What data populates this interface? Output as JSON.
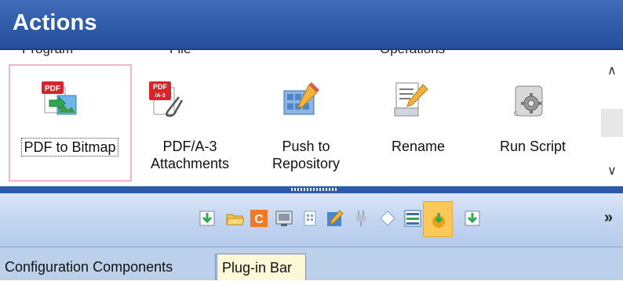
{
  "header": {
    "title": "Actions"
  },
  "categories": [
    {
      "id": "program",
      "label": "Program"
    },
    {
      "id": "file",
      "label": "File"
    },
    {
      "id": "operations",
      "label": "Operations"
    }
  ],
  "actions": [
    {
      "id": "pdf-to-bitmap",
      "label_lines": [
        "PDF to Bitmap",
        ""
      ],
      "icon": "pdf-to-bitmap-icon",
      "selected": true
    },
    {
      "id": "pdfa3-attachments",
      "label_lines": [
        "PDF/A-3",
        "Attachments"
      ],
      "icon": "pdfa3-attachment-icon",
      "selected": false
    },
    {
      "id": "push-to-repository",
      "label_lines": [
        "Push to",
        "Repository"
      ],
      "icon": "repository-icon",
      "selected": false
    },
    {
      "id": "rename",
      "label_lines": [
        "Rename",
        ""
      ],
      "icon": "rename-icon",
      "selected": false
    },
    {
      "id": "run-script",
      "label_lines": [
        "Run Script",
        ""
      ],
      "icon": "script-gear-icon",
      "selected": false
    }
  ],
  "icon_badges": {
    "pdf": "PDF",
    "pdfa": "PDF",
    "pdfa_sub": "/A-3"
  },
  "toolbar": {
    "items": [
      "download-icon",
      "folder-icon",
      "c-icon",
      "console-icon",
      "page-icon",
      "edit-icon",
      "plug-icon",
      "diamond-icon",
      "layout-icon",
      "plugin-bar-icon",
      "export-icon"
    ],
    "active_item": "plugin-bar-icon",
    "c_letter": "C"
  },
  "tabs": [
    {
      "label": "Configuration Components",
      "active": false
    },
    {
      "label": "Plug-in Bar",
      "active": true
    }
  ],
  "colors": {
    "header": "#2f5aa8",
    "selection_frame": "#f4b6c6",
    "active_tab": "#fff8d8",
    "toolbar_active": "#fbc85a",
    "pdf_red": "#d7262b"
  }
}
